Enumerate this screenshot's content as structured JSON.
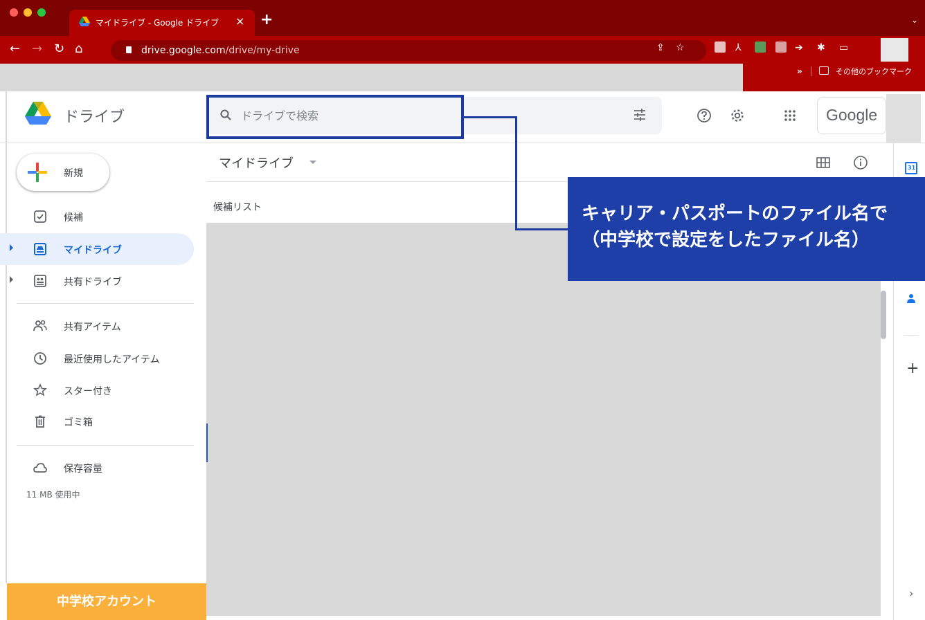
{
  "browser": {
    "tab_title": "マイドライブ - Google ドライブ",
    "tab_close": "×",
    "new_tab": "+",
    "url_host": "drive.google.com",
    "url_path": "/drive/my-drive",
    "bookmarks_overflow": "»",
    "other_bookmarks": "その他のブックマーク"
  },
  "drive": {
    "app_name": "ドライブ",
    "search_placeholder": "ドライブで検索",
    "google_label": "Google"
  },
  "sidebar": {
    "new_label": "新規",
    "items": [
      {
        "label": "候補",
        "icon": "suggested-icon"
      },
      {
        "label": "マイドライブ",
        "icon": "my-drive-icon"
      },
      {
        "label": "共有ドライブ",
        "icon": "shared-drives-icon"
      },
      {
        "label": "共有アイテム",
        "icon": "shared-icon"
      },
      {
        "label": "最近使用したアイテム",
        "icon": "clock-icon"
      },
      {
        "label": "スター付き",
        "icon": "star-icon"
      },
      {
        "label": "ゴミ箱",
        "icon": "trash-icon"
      },
      {
        "label": "保存容量",
        "icon": "cloud-icon"
      }
    ],
    "storage_used": "11 MB 使用中",
    "account_badge": "中学校アカウント"
  },
  "main": {
    "breadcrumb": "マイドライブ",
    "section_title": "候補リスト"
  },
  "right_panel": {
    "calendar_day": "31",
    "add": "+",
    "expand": "›"
  },
  "callout": {
    "line1": "キャリア・パスポートのファイル名で",
    "line2": "（中学校で設定をしたファイル名）"
  },
  "colors": {
    "chrome_dark": "#7d0303",
    "chrome": "#b10202",
    "callout": "#1f3fa8",
    "badge": "#fbb03b",
    "active_nav": "#e8f0fe"
  }
}
